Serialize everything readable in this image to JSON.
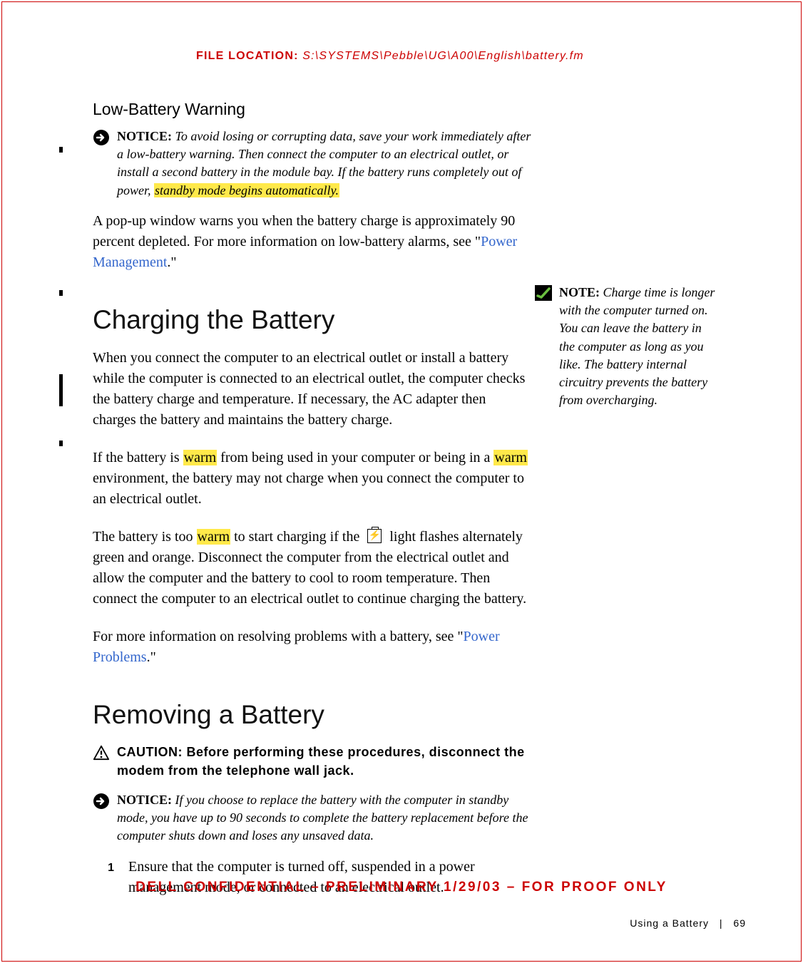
{
  "header": {
    "file_label": "FILE LOCATION:",
    "file_path": "S:\\SYSTEMS\\Pebble\\UG\\A00\\English\\battery.fm"
  },
  "low_battery": {
    "heading": "Low-Battery Warning",
    "notice_label": "NOTICE:",
    "notice_text_a": " To avoid losing or corrupting data, save your work immediately after a low-battery warning. Then connect the computer to an electrical outlet, or install a second battery in the module bay. If the battery runs completely out of power, ",
    "notice_hl": "standby mode begins automatically.",
    "para_a": "A pop-up window warns you when the battery charge is approximately 90 percent depleted. For more information on low-battery alarms, see \"",
    "para_link": "Power Management",
    "para_b": ".\""
  },
  "charging": {
    "heading": "Charging the Battery",
    "p1": "When you connect the computer to an electrical outlet or install a battery while the computer is connected to an electrical outlet, the computer checks the battery charge and temperature. If necessary, the AC adapter then charges the battery and maintains the battery charge.",
    "p2_a": "If the battery is ",
    "p2_hl1": "warm",
    "p2_b": " from being used in your computer or being in a ",
    "p2_hl2": "warm",
    "p2_c": " environment, the battery may not charge when you connect the computer to an electrical outlet.",
    "p3_a": "The battery is too ",
    "p3_hl": "warm",
    "p3_b": " to start charging if the ",
    "p3_c": " light flashes alternately green and orange. Disconnect the computer from the electrical outlet and allow the computer and the battery to cool to room temperature. Then connect the computer to an electrical outlet to continue charging the battery.",
    "p4_a": "For more information on resolving problems with a battery, see \"",
    "p4_link": "Power Problems",
    "p4_b": ".\"",
    "side_label": "NOTE:",
    "side_text": " Charge time is longer with the computer turned on. You can leave the battery in the computer as long as you like. The battery internal circuitry prevents the battery from overcharging."
  },
  "removing": {
    "heading": "Removing a Battery",
    "caution_label": "CAUTION: ",
    "caution_text": "Before performing these procedures, disconnect the modem from the telephone wall jack.",
    "notice_label": "NOTICE:",
    "notice_text": " If you choose to replace the battery with the computer in standby mode, you have up to 90 seconds to complete the battery replacement before the computer shuts down and loses any unsaved data.",
    "step1_num": "1",
    "step1_text": "Ensure that the computer is turned off, suspended in a power management mode, or connected to an electrical outlet."
  },
  "footer": {
    "confidential": "DELL CONFIDENTIAL – PRELIMINARY 1/29/03 – FOR PROOF ONLY",
    "section": "Using a Battery",
    "page": "69"
  }
}
